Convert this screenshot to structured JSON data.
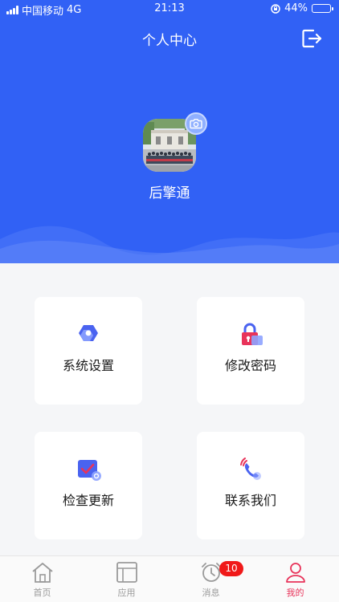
{
  "status_bar": {
    "carrier": "中国移动",
    "network": "4G",
    "time": "21:13",
    "battery": "44%",
    "battery_level": 0.44
  },
  "header": {
    "title": "个人中心",
    "logout_icon": "logout-icon"
  },
  "profile": {
    "name": "后擎通",
    "camera_icon": "camera-icon"
  },
  "menu": [
    {
      "label": "系统设置",
      "icon": "settings-icon"
    },
    {
      "label": "修改密码",
      "icon": "lock-icon"
    },
    {
      "label": "检查更新",
      "icon": "update-check-icon"
    },
    {
      "label": "联系我们",
      "icon": "phone-icon"
    }
  ],
  "tabbar": {
    "items": [
      {
        "label": "首页",
        "icon": "home-icon"
      },
      {
        "label": "应用",
        "icon": "apps-icon"
      },
      {
        "label": "消息",
        "icon": "alarm-clock-icon"
      },
      {
        "label": "我的",
        "icon": "user-icon",
        "active": true
      }
    ],
    "message_badge": "10"
  },
  "colors": {
    "primary": "#3161f5",
    "active_tab": "#e8335a",
    "badge": "#f01919",
    "background": "#f5f6f8"
  }
}
